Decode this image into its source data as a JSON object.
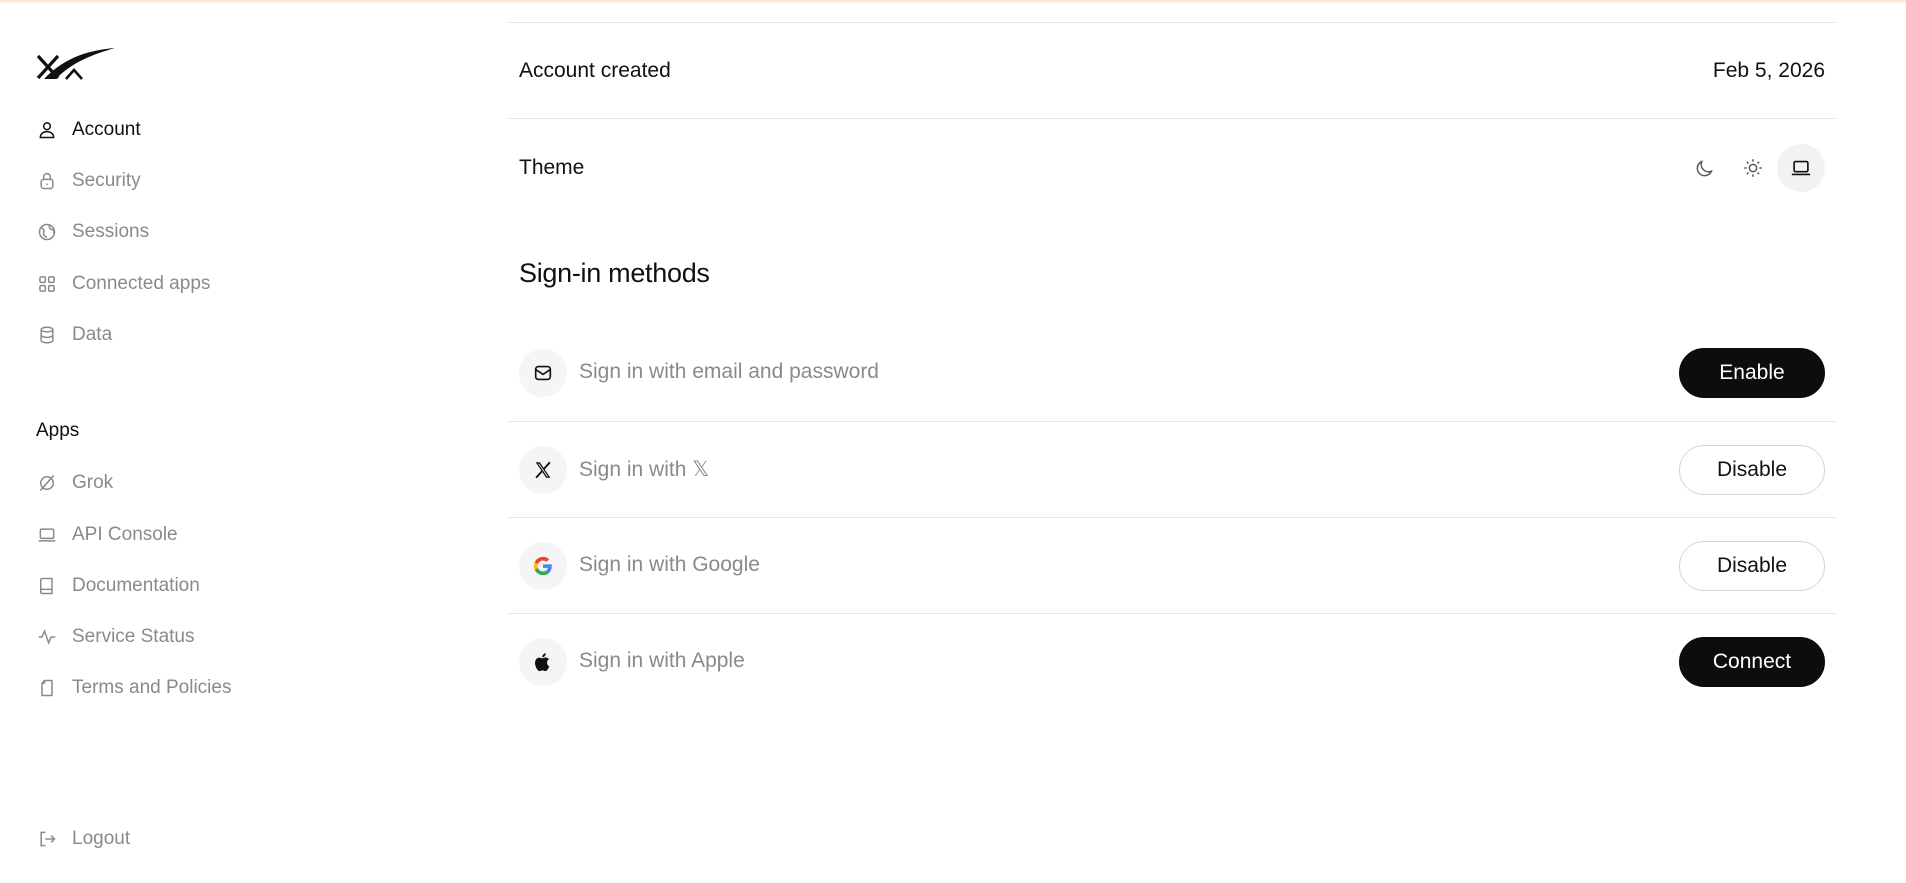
{
  "sidebar": {
    "logo": "xAI",
    "account_items": [
      {
        "label": "Account",
        "icon": "user-icon",
        "active": true
      },
      {
        "label": "Security",
        "icon": "lock-icon",
        "active": false
      },
      {
        "label": "Sessions",
        "icon": "globe-icon",
        "active": false
      },
      {
        "label": "Connected apps",
        "icon": "grid-icon",
        "active": false
      },
      {
        "label": "Data",
        "icon": "database-icon",
        "active": false
      }
    ],
    "apps_title": "Apps",
    "app_items": [
      {
        "label": "Grok",
        "icon": "grok-icon"
      },
      {
        "label": "API Console",
        "icon": "laptop-icon"
      },
      {
        "label": "Documentation",
        "icon": "book-icon"
      },
      {
        "label": "Service Status",
        "icon": "activity-icon"
      },
      {
        "label": "Terms and Policies",
        "icon": "document-icon"
      }
    ],
    "logout_label": "Logout"
  },
  "account": {
    "created_label": "Account created",
    "created_value": "Feb 5, 2026",
    "theme_label": "Theme",
    "theme_options": [
      "dark",
      "light",
      "system"
    ],
    "theme_selected": "system"
  },
  "sign_in": {
    "heading": "Sign-in methods",
    "methods": [
      {
        "label": "Sign in with email and password",
        "icon": "mail-icon",
        "action": "Enable",
        "style": "dark"
      },
      {
        "label": "Sign in with 𝕏",
        "icon": "x-icon",
        "action": "Disable",
        "style": "light"
      },
      {
        "label": "Sign in with Google",
        "icon": "google-icon",
        "action": "Disable",
        "style": "light"
      },
      {
        "label": "Sign in with Apple",
        "icon": "apple-icon",
        "action": "Connect",
        "style": "dark"
      }
    ]
  },
  "colors": {
    "text_primary": "#111111",
    "text_muted": "#8a8a8a",
    "button_dark": "#0d0d0d",
    "divider": "#e8e8e8"
  }
}
